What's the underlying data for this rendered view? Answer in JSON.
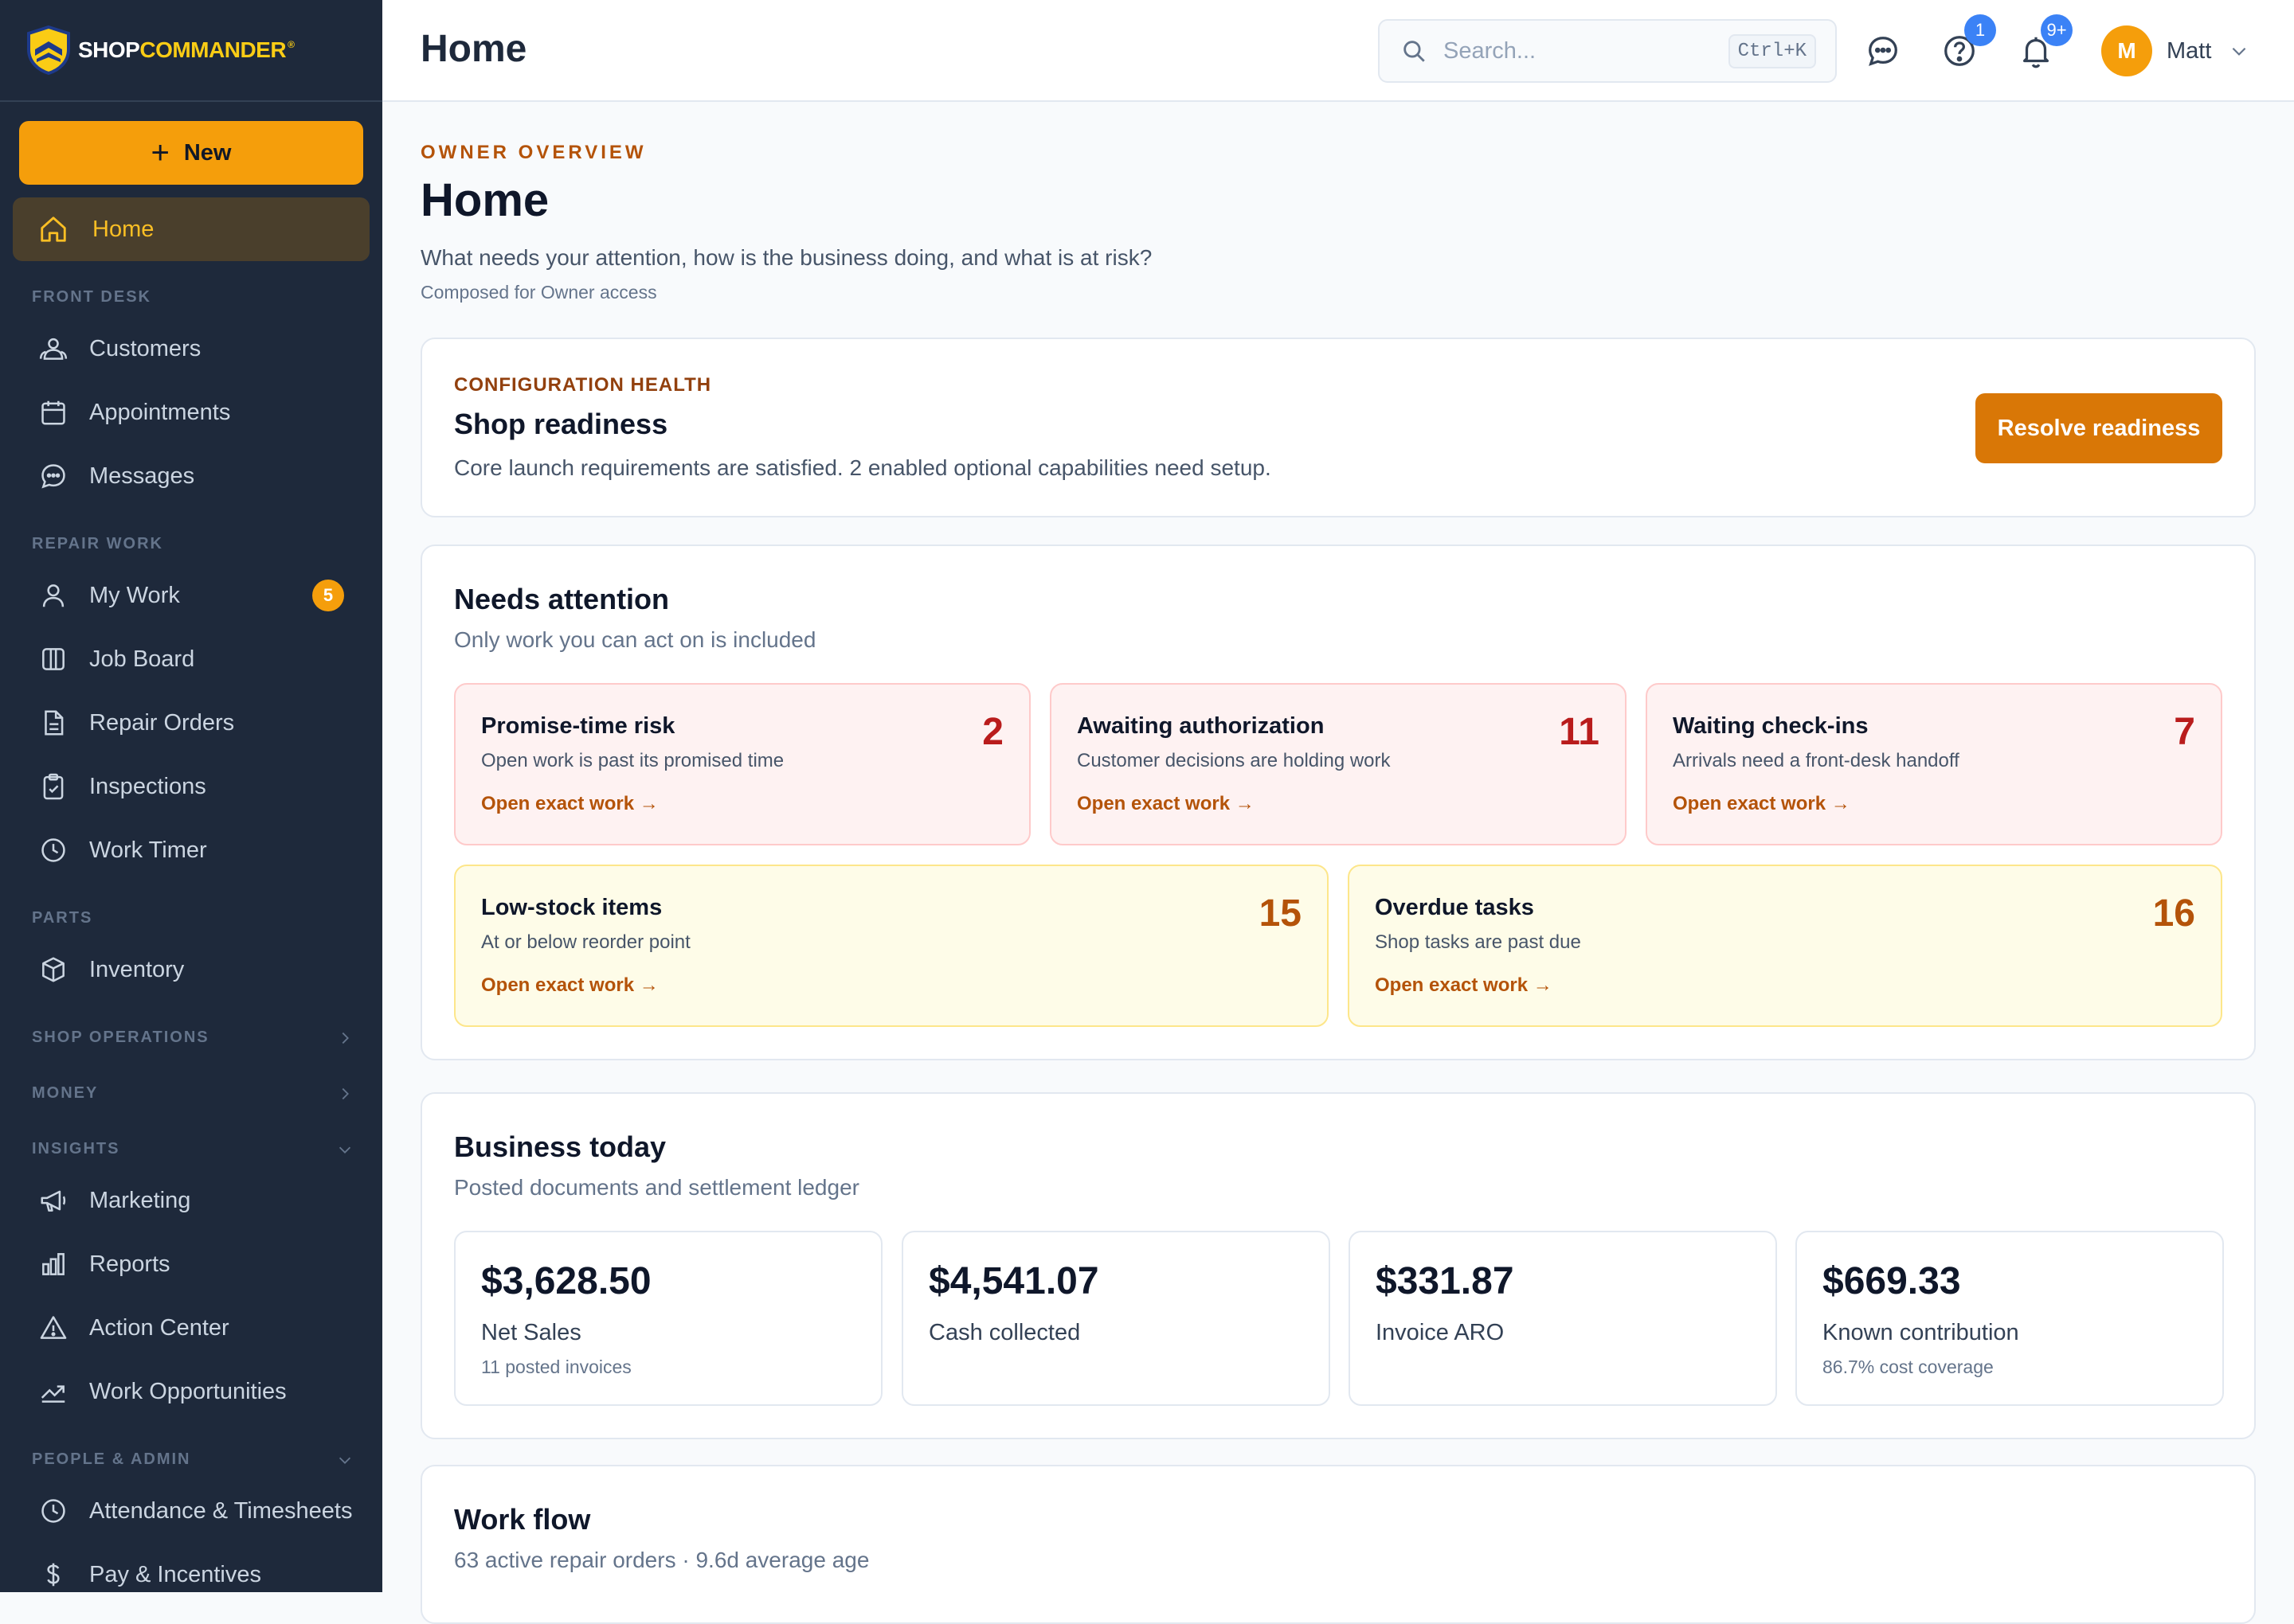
{
  "brand": {
    "shop": "SHOP",
    "commander": "COMMANDER",
    "reg": "®"
  },
  "colors": {
    "accent": "#f59e0b",
    "sidebar_bg": "#1e293b",
    "danger": "#b91c1c",
    "warning": "#b45309"
  },
  "sidebar": {
    "new_label": "New",
    "home_label": "Home",
    "sections": {
      "front_desk": "FRONT DESK",
      "repair_work": "REPAIR WORK",
      "parts": "PARTS",
      "shop_operations": "SHOP OPERATIONS",
      "money": "MONEY",
      "insights": "INSIGHTS",
      "people_admin": "PEOPLE & ADMIN"
    },
    "items": {
      "customers": "Customers",
      "appointments": "Appointments",
      "messages": "Messages",
      "my_work": "My Work",
      "my_work_badge": "5",
      "job_board": "Job Board",
      "repair_orders": "Repair Orders",
      "inspections": "Inspections",
      "work_timer": "Work Timer",
      "inventory": "Inventory",
      "marketing": "Marketing",
      "reports": "Reports",
      "action_center": "Action Center",
      "work_opportunities": "Work Opportunities",
      "attendance": "Attendance & Timesheets",
      "pay": "Pay & Incentives"
    }
  },
  "topbar": {
    "title": "Home",
    "search_placeholder": "Search...",
    "search_shortcut": "Ctrl+K",
    "help_badge": "1",
    "notif_badge": "9+",
    "user_initial": "M",
    "user_name": "Matt"
  },
  "page": {
    "eyebrow": "OWNER OVERVIEW",
    "title": "Home",
    "subtitle": "What needs your attention, how is the business doing, and what is at risk?",
    "note": "Composed for Owner access"
  },
  "readiness": {
    "kicker": "CONFIGURATION HEALTH",
    "title": "Shop readiness",
    "text": "Core launch requirements are satisfied. 2 enabled optional capabilities need setup.",
    "button": "Resolve readiness"
  },
  "attention": {
    "title": "Needs attention",
    "subtitle": "Only work you can act on is included",
    "link_label": "Open exact work →",
    "tiles": [
      {
        "title": "Promise-time risk",
        "desc": "Open work is past its promised time",
        "count": "2"
      },
      {
        "title": "Awaiting authorization",
        "desc": "Customer decisions are holding work",
        "count": "11"
      },
      {
        "title": "Waiting check-ins",
        "desc": "Arrivals need a front-desk handoff",
        "count": "7"
      },
      {
        "title": "Low-stock items",
        "desc": "At or below reorder point",
        "count": "15"
      },
      {
        "title": "Overdue tasks",
        "desc": "Shop tasks are past due",
        "count": "16"
      }
    ]
  },
  "business": {
    "title": "Business today",
    "subtitle": "Posted documents and settlement ledger",
    "metrics": [
      {
        "value": "$3,628.50",
        "label": "Net Sales",
        "note": "11 posted invoices"
      },
      {
        "value": "$4,541.07",
        "label": "Cash collected",
        "note": ""
      },
      {
        "value": "$331.87",
        "label": "Invoice ARO",
        "note": ""
      },
      {
        "value": "$669.33",
        "label": "Known contribution",
        "note": "86.7% cost coverage"
      }
    ]
  },
  "workflow": {
    "title": "Work flow",
    "subtitle": "63 active repair orders · 9.6d average age"
  }
}
